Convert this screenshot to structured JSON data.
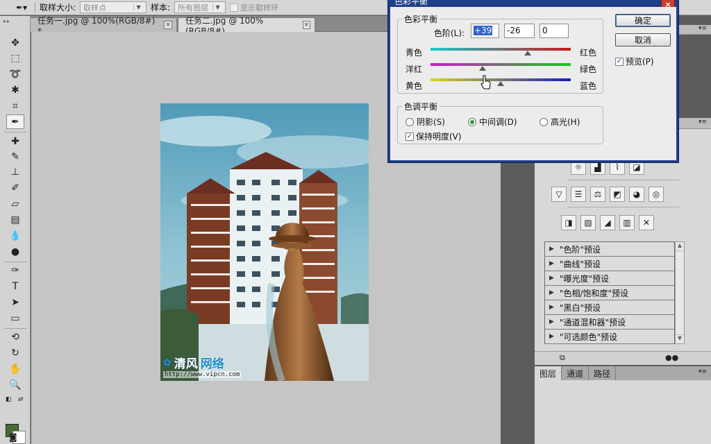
{
  "options_bar": {
    "sample_size_label": "取样大小:",
    "sample_size_value": "取样点",
    "sample_label": "样本:",
    "sample_value": "所有图层",
    "show_ring_label": "显示取样环"
  },
  "tabs": [
    {
      "label": "任务一.jpg @ 100%(RGB/8#) *",
      "close": "×"
    },
    {
      "label": "任务二.jpg @ 100%(RGB/8#)",
      "close": "×"
    }
  ],
  "watermark": {
    "brand_a": "清风",
    "brand_b": "网络",
    "url": "http://www.vipcn.com"
  },
  "adjustments": {
    "presets": [
      "\"色阶\"预设",
      "\"曲线\"预设",
      "\"曝光度\"预设",
      "\"色相/饱和度\"预设",
      "\"黑白\"预设",
      "\"通道混和器\"预设",
      "\"可选颜色\"预设"
    ]
  },
  "layers_tabs": [
    "图层",
    "通道",
    "路径"
  ],
  "dialog": {
    "title": "色彩平衡",
    "close": "×",
    "color_balance_group": "色彩平衡",
    "levels_label": "色阶(L):",
    "levels": [
      "+39",
      "-26",
      "0"
    ],
    "sliders": [
      {
        "left": "青色",
        "right": "红色",
        "value": 39
      },
      {
        "left": "洋红",
        "right": "绿色",
        "value": -26
      },
      {
        "left": "黄色",
        "right": "蓝色",
        "value": 0
      }
    ],
    "tone_group": "色调平衡",
    "tones": [
      "阴影(S)",
      "中间调(D)",
      "高光(H)"
    ],
    "selected_tone": "中间调(D)",
    "preserve_luminosity": "保持明度(V)",
    "ok": "确定",
    "cancel": "取消",
    "preview": "预览(P)"
  },
  "colors": {
    "foreground": "#4a6b33",
    "background": "#ffffff",
    "dialog_title_bar": "#1f3f86"
  }
}
